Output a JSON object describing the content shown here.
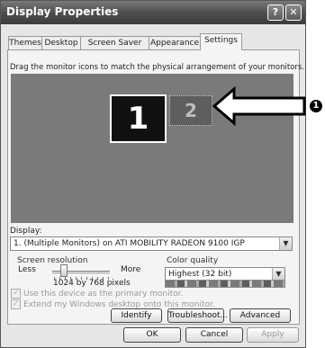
{
  "window": {
    "title": "Display Properties",
    "help_button": "?",
    "close_button": "✕"
  },
  "tabs": [
    {
      "label": "Themes",
      "active": false
    },
    {
      "label": "Desktop",
      "active": false
    },
    {
      "label": "Screen Saver",
      "active": false
    },
    {
      "label": "Appearance",
      "active": false
    },
    {
      "label": "Settings",
      "active": true
    }
  ],
  "settings": {
    "instruction": "Drag the monitor icons to match the physical arrangement of your monitors.",
    "monitors": [
      {
        "number": "1",
        "state": "primary-selected"
      },
      {
        "number": "2",
        "state": "inactive"
      }
    ],
    "callout_number": "1",
    "display_label": "Display:",
    "display_value": "1. (Multiple Monitors) on ATI MOBILITY RADEON 9100 IGP",
    "resolution": {
      "group_label": "Screen resolution",
      "less_label": "Less",
      "more_label": "More",
      "value_text": "1024 by 768 pixels",
      "slider_level": 0.15
    },
    "color_quality": {
      "group_label": "Color quality",
      "selected": "Highest (32 bit)"
    },
    "options": [
      {
        "label": "Use this device as the primary monitor.",
        "checked": true,
        "enabled": false
      },
      {
        "label": "Extend my Windows desktop onto this monitor.",
        "checked": true,
        "enabled": false
      }
    ],
    "buttons": {
      "identify": "Identify",
      "troubleshoot": "Troubleshoot...",
      "advanced": "Advanced"
    }
  },
  "footer": {
    "ok": "OK",
    "cancel": "Cancel",
    "apply": "Apply"
  },
  "colors": {
    "monitor_area": "#7a7a7a",
    "title_bar": "#4e4e4e",
    "callout_arrow": "#000000"
  },
  "icons": [
    "help-icon",
    "close-icon",
    "arrow-callout-icon",
    "dropdown-arrow-icon",
    "checkbox-checked-icon"
  ]
}
